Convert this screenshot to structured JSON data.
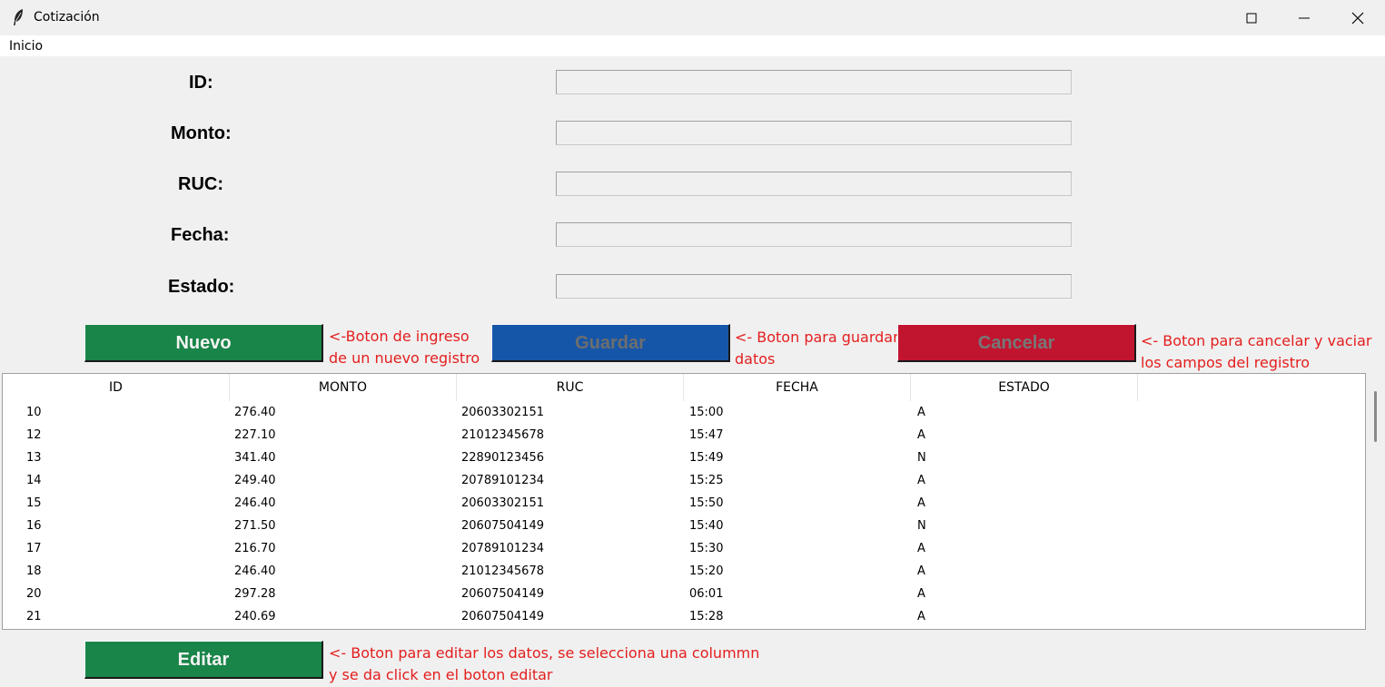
{
  "window": {
    "title": "Cotización",
    "icon": "feather-icon"
  },
  "menu": {
    "items": [
      "Inicio"
    ]
  },
  "form": {
    "fields": [
      {
        "label": "ID:",
        "value": ""
      },
      {
        "label": "Monto:",
        "value": ""
      },
      {
        "label": "RUC:",
        "value": ""
      },
      {
        "label": "Fecha:",
        "value": ""
      },
      {
        "label": "Estado:",
        "value": ""
      }
    ]
  },
  "buttons": {
    "nuevo": "Nuevo",
    "guardar": "Guardar",
    "cancelar": "Cancelar",
    "editar": "Editar"
  },
  "notes": {
    "nuevo": [
      "<-Boton de ingreso",
      "de un nuevo registro"
    ],
    "guardar": [
      "<- Boton para guardar",
      "datos"
    ],
    "cancelar": [
      "<- Boton para cancelar y vaciar",
      "los campos del registro"
    ],
    "editar": [
      "<- Boton para editar los datos, se selecciona una colummn",
      "y se da click en el boton editar"
    ]
  },
  "table": {
    "columns": [
      "ID",
      "MONTO",
      "RUC",
      "FECHA",
      "ESTADO"
    ],
    "rows": [
      [
        "10",
        "276.40",
        "20603302151",
        "15:00",
        "A"
      ],
      [
        "12",
        "227.10",
        "21012345678",
        "15:47",
        "A"
      ],
      [
        "13",
        "341.40",
        "22890123456",
        "15:49",
        "N"
      ],
      [
        "14",
        "249.40",
        "20789101234",
        "15:25",
        "A"
      ],
      [
        "15",
        "246.40",
        "20603302151",
        "15:50",
        "A"
      ],
      [
        "16",
        "271.50",
        "20607504149",
        "15:40",
        "N"
      ],
      [
        "17",
        "216.70",
        "20789101234",
        "15:30",
        "A"
      ],
      [
        "18",
        "246.40",
        "21012345678",
        "15:20",
        "A"
      ],
      [
        "20",
        "297.28",
        "20607504149",
        "06:01",
        "A"
      ],
      [
        "21",
        "240.69",
        "20607504149",
        "15:28",
        "A"
      ]
    ]
  },
  "colors": {
    "green": "#198548",
    "blue": "#1656a8",
    "red": "#c1152f",
    "note": "#e41e1e"
  }
}
